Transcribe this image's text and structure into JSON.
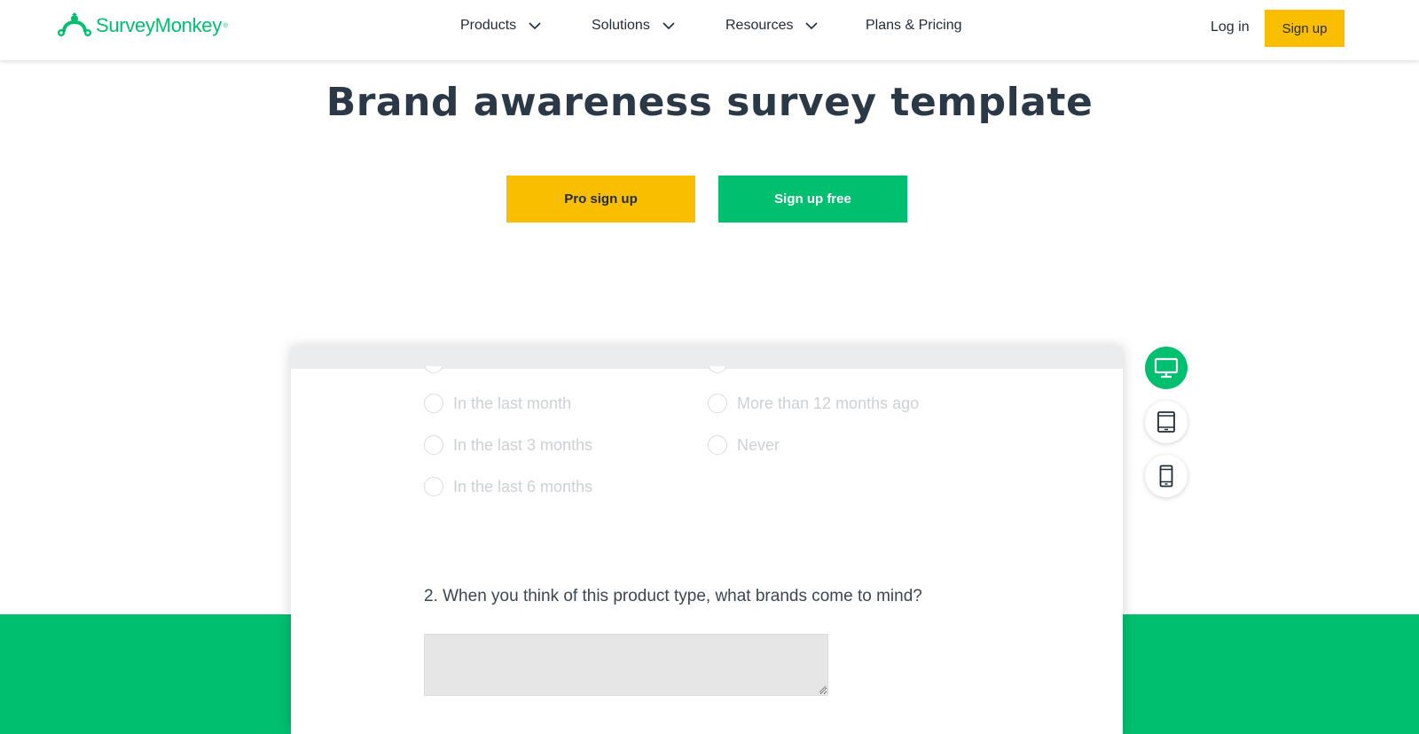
{
  "header": {
    "logo_text": "SurveyMonkey",
    "logo_trademark": "®",
    "nav": [
      {
        "label": "Products",
        "has_dropdown": true
      },
      {
        "label": "Solutions",
        "has_dropdown": true
      },
      {
        "label": "Resources",
        "has_dropdown": true
      },
      {
        "label": "Plans & Pricing",
        "has_dropdown": false
      }
    ],
    "login_label": "Log in",
    "signup_label": "Sign up"
  },
  "page": {
    "title": "Brand awareness survey template",
    "pro_signup_label": "Pro sign up",
    "free_signup_label": "Sign up free"
  },
  "preview": {
    "options_col1": [
      "In the last month",
      "In the last 3 months",
      "In the last 6 months"
    ],
    "options_col2": [
      "More than 12 months ago",
      "Never"
    ],
    "question_2": "2. When you think of this product type, what brands come to mind?",
    "answer_value": ""
  },
  "device_toggles": [
    {
      "icon": "desktop-icon",
      "active": true
    },
    {
      "icon": "tablet-icon",
      "active": false
    },
    {
      "icon": "mobile-icon",
      "active": false
    }
  ],
  "colors": {
    "brand_green": "#00bf6f",
    "accent_yellow": "#f9be00",
    "text_dark": "#1f2b37",
    "option_muted": "#cdd1d4"
  }
}
